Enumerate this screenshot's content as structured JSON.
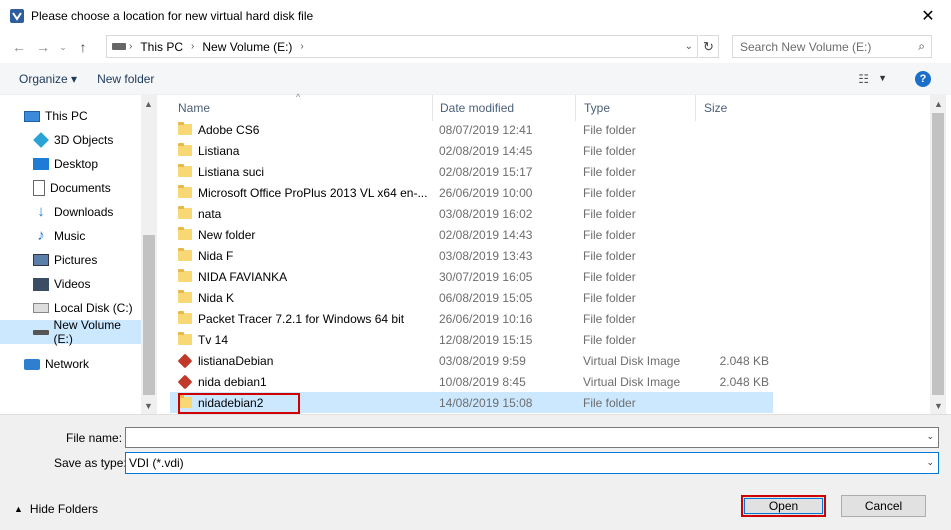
{
  "window": {
    "title": "Please choose a location for new virtual hard disk file"
  },
  "address": {
    "crumbs": [
      "This PC",
      "New Volume (E:)"
    ],
    "search_placeholder": "Search New Volume (E:)"
  },
  "toolbar": {
    "organize": "Organize ▾",
    "new_folder": "New folder"
  },
  "nav": {
    "items": [
      {
        "label": "This PC",
        "icon": "pc-icon"
      },
      {
        "label": "3D Objects",
        "icon": "3d-objects-icon"
      },
      {
        "label": "Desktop",
        "icon": "desktop-icon"
      },
      {
        "label": "Documents",
        "icon": "documents-icon"
      },
      {
        "label": "Downloads",
        "icon": "downloads-icon"
      },
      {
        "label": "Music",
        "icon": "music-icon"
      },
      {
        "label": "Pictures",
        "icon": "pictures-icon"
      },
      {
        "label": "Videos",
        "icon": "videos-icon"
      },
      {
        "label": "Local Disk (C:)",
        "icon": "drive-icon"
      },
      {
        "label": "New Volume (E:)",
        "icon": "drive-icon",
        "selected": true
      },
      {
        "label": "Network",
        "icon": "network-icon"
      }
    ]
  },
  "columns": {
    "name": "Name",
    "date": "Date modified",
    "type": "Type",
    "size": "Size"
  },
  "files": [
    {
      "name": "Adobe CS6",
      "date": "08/07/2019 12:41",
      "type": "File folder",
      "size": "",
      "icon": "folder-icon"
    },
    {
      "name": "Listiana",
      "date": "02/08/2019 14:45",
      "type": "File folder",
      "size": "",
      "icon": "folder-icon"
    },
    {
      "name": "Listiana suci",
      "date": "02/08/2019 15:17",
      "type": "File folder",
      "size": "",
      "icon": "folder-icon"
    },
    {
      "name": "Microsoft Office ProPlus 2013 VL x64 en-...",
      "date": "26/06/2019 10:00",
      "type": "File folder",
      "size": "",
      "icon": "folder-icon"
    },
    {
      "name": "nata",
      "date": "03/08/2019 16:02",
      "type": "File folder",
      "size": "",
      "icon": "folder-icon"
    },
    {
      "name": "New folder",
      "date": "02/08/2019 14:43",
      "type": "File folder",
      "size": "",
      "icon": "folder-icon"
    },
    {
      "name": "Nida F",
      "date": "03/08/2019 13:43",
      "type": "File folder",
      "size": "",
      "icon": "folder-icon"
    },
    {
      "name": "NIDA FAVIANKA",
      "date": "30/07/2019 16:05",
      "type": "File folder",
      "size": "",
      "icon": "folder-icon"
    },
    {
      "name": "Nida K",
      "date": "06/08/2019 15:05",
      "type": "File folder",
      "size": "",
      "icon": "folder-icon"
    },
    {
      "name": "Packet Tracer 7.2.1 for Windows 64 bit",
      "date": "26/06/2019 10:16",
      "type": "File folder",
      "size": "",
      "icon": "folder-icon"
    },
    {
      "name": "Tv 14",
      "date": "12/08/2019 15:15",
      "type": "File folder",
      "size": "",
      "icon": "folder-icon"
    },
    {
      "name": "listianaDebian",
      "date": "03/08/2019 9:59",
      "type": "Virtual Disk Image",
      "size": "2.048 KB",
      "icon": "virtualbox-disk-icon"
    },
    {
      "name": "nida debian1",
      "date": "10/08/2019 8:45",
      "type": "Virtual Disk Image",
      "size": "2.048 KB",
      "icon": "virtualbox-disk-icon"
    },
    {
      "name": "nidadebian2",
      "date": "14/08/2019 15:08",
      "type": "File folder",
      "size": "",
      "icon": "folder-icon",
      "selected": true
    }
  ],
  "footer": {
    "filename_label": "File name:",
    "filename_value": "",
    "savetype_label": "Save as type:",
    "savetype_value": "VDI (*.vdi)",
    "hide_folders": "Hide Folders",
    "open": "Open",
    "cancel": "Cancel"
  },
  "colors": {
    "selection": "#cce8ff",
    "highlight_box": "#d00000",
    "accent": "#0078d7"
  }
}
